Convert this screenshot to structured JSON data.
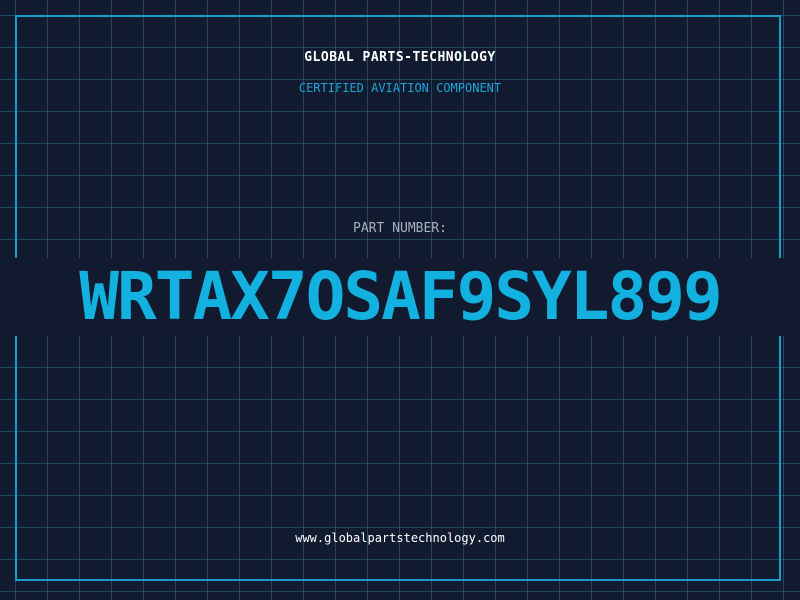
{
  "header": {
    "company": "GLOBAL PARTS-TECHNOLOGY",
    "subtitle": "CERTIFIED AVIATION COMPONENT"
  },
  "part": {
    "label": "PART NUMBER:",
    "number": "WRTAX7OSAF9SYL899"
  },
  "footer": {
    "website": "www.globalpartstechnology.com"
  },
  "colors": {
    "background": "#111a2e",
    "grid": "#286e8c",
    "accent": "#12b1e0",
    "label": "#a7b1c2",
    "text": "#ffffff"
  }
}
